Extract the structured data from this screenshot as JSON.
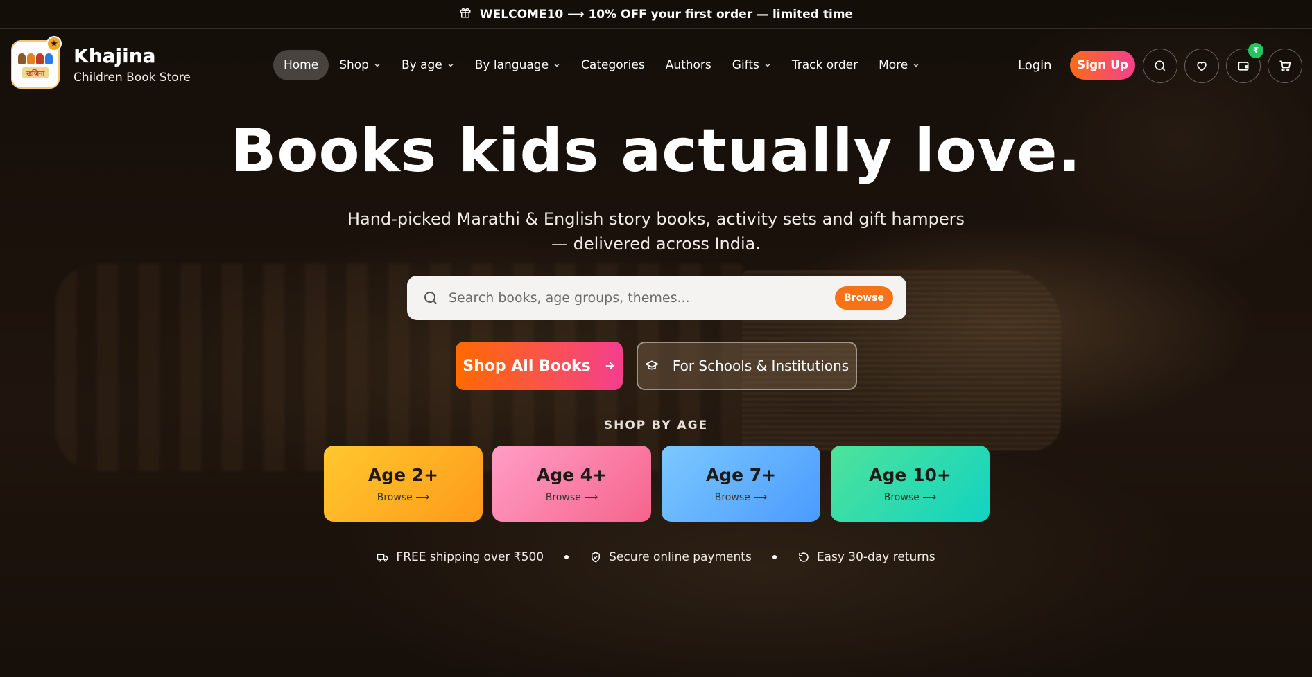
{
  "announcement": {
    "text": "WELCOME10 ⟶ 10% OFF your first order — limited time"
  },
  "brand": {
    "name": "Khajina",
    "tagline": "Children Book Store",
    "logo_text": "खजिना"
  },
  "nav": {
    "items": [
      {
        "label": "Home",
        "active": true,
        "dropdown": false
      },
      {
        "label": "Shop",
        "dropdown": true
      },
      {
        "label": "By age",
        "dropdown": true
      },
      {
        "label": "By language",
        "dropdown": true
      },
      {
        "label": "Categories",
        "dropdown": false
      },
      {
        "label": "Authors",
        "dropdown": false
      },
      {
        "label": "Gifts",
        "dropdown": true
      },
      {
        "label": "Track order",
        "dropdown": false
      },
      {
        "label": "More",
        "dropdown": true
      }
    ]
  },
  "header_actions": {
    "login": "Login",
    "signup": "Sign Up",
    "wallet_badge": "₹",
    "icons": [
      "search-icon",
      "heart-icon",
      "wallet-icon",
      "cart-icon"
    ]
  },
  "hero": {
    "title": "Books kids actually love.",
    "subtitle_line1": "Hand-picked Marathi & English story books, activity sets and gift hampers",
    "subtitle_line2": "— delivered across India.",
    "search_placeholder": "Search books, age groups, themes...",
    "search_button": "Browse",
    "cta_primary": "Shop All Books",
    "cta_secondary": "For Schools & Institutions"
  },
  "shop_by_age": {
    "label": "SHOP BY AGE",
    "cards": [
      {
        "title": "Age 2+",
        "sub": "Browse ⟶"
      },
      {
        "title": "Age 4+",
        "sub": "Browse ⟶"
      },
      {
        "title": "Age 7+",
        "sub": "Browse ⟶"
      },
      {
        "title": "Age 10+",
        "sub": "Browse ⟶"
      }
    ]
  },
  "trust": {
    "shipping": "FREE shipping over ₹500",
    "payments": "Secure online payments",
    "returns": "Easy 30-day returns"
  },
  "colors": {
    "accent_orange": "#f97316",
    "gradient_pink": "#f43f8e",
    "age2": "#fbbf24",
    "age4": "#f472b6",
    "age7": "#60a5fa",
    "age10": "#34d399",
    "badge_green": "#22c55e"
  }
}
